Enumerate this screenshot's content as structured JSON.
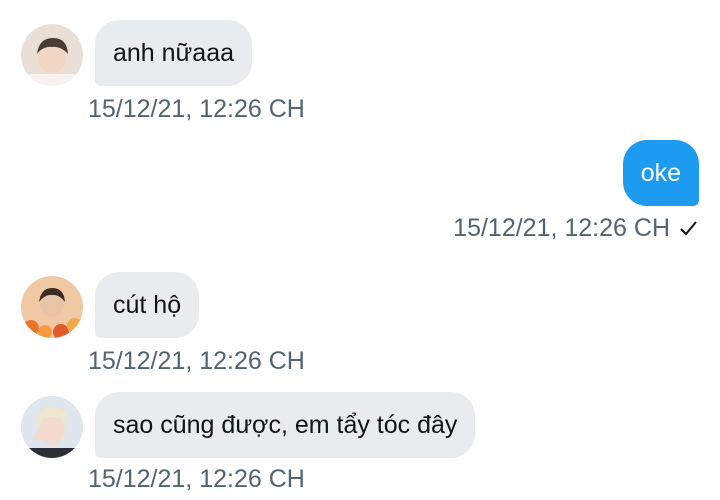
{
  "messages": [
    {
      "direction": "incoming",
      "text": "anh nữaaa",
      "timestamp": "15/12/21, 12:26 CH"
    },
    {
      "direction": "outgoing",
      "text": "oke",
      "timestamp": "15/12/21, 12:26 CH",
      "status_icon": "check-icon"
    },
    {
      "direction": "incoming",
      "text": "cút hộ",
      "timestamp": "15/12/21, 12:26 CH"
    },
    {
      "direction": "incoming",
      "text": "sao cũng được, em tẩy tóc đây",
      "timestamp": "15/12/21, 12:26 CH"
    }
  ],
  "colors": {
    "incoming_bubble": "#e8ecef",
    "outgoing_bubble": "#1d9bf0",
    "timestamp": "#536471"
  }
}
